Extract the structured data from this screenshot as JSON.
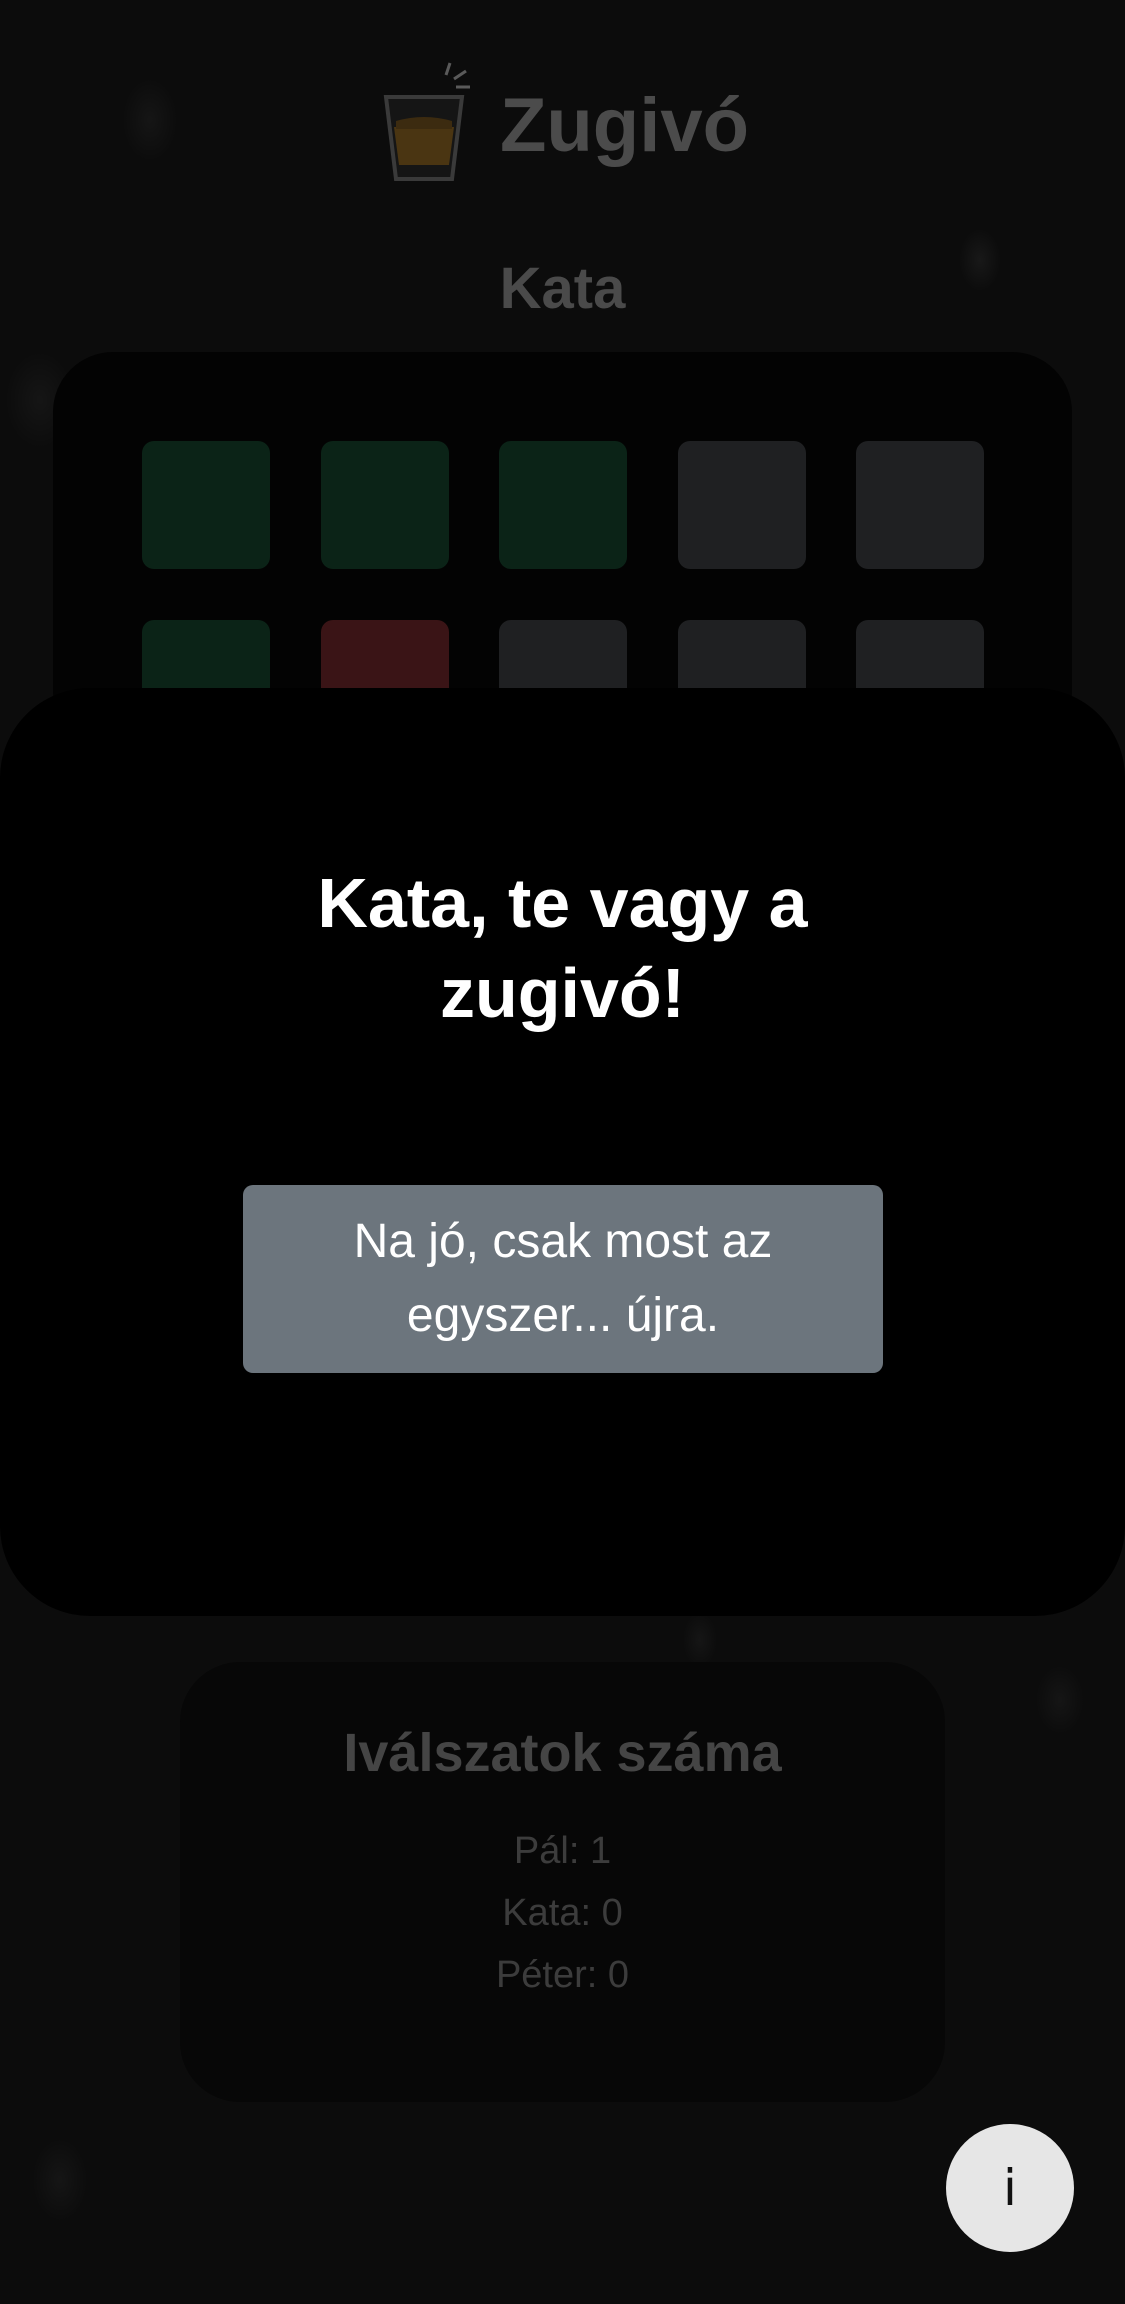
{
  "header": {
    "app_title": "Zugivó",
    "logo_icon": "shot-glass-icon"
  },
  "current_player": "Kata",
  "grid": {
    "cells": [
      {
        "state": "drunk",
        "color": "#0b2317"
      },
      {
        "state": "drunk",
        "color": "#0b2317"
      },
      {
        "state": "drunk",
        "color": "#0b2317"
      },
      {
        "state": "unrevealed",
        "color": "#1f2022"
      },
      {
        "state": "unrevealed",
        "color": "#1f2022"
      },
      {
        "state": "drunk",
        "color": "#0b2317"
      },
      {
        "state": "loser",
        "color": "#3a1416"
      },
      {
        "state": "unrevealed",
        "color": "#1f2022"
      },
      {
        "state": "unrevealed",
        "color": "#1f2022"
      },
      {
        "state": "unrevealed",
        "color": "#1f2022"
      }
    ]
  },
  "modal": {
    "title_line1": "Kata, te vagy a",
    "title_line2": "zugivó!",
    "button_line1": "Na jó, csak most az",
    "button_line2": "egyszer... újra."
  },
  "stats": {
    "title": "Iválszatok száma",
    "rows": [
      "Pál: 1",
      "Kata: 0",
      "Péter: 0"
    ]
  },
  "info_button": {
    "label": "i",
    "icon": "info-icon"
  },
  "colors": {
    "button_bg": "#6c757d",
    "modal_bg": "#000000",
    "page_bg": "#0c0c0c",
    "green_cell": "#0b2317",
    "red_cell": "#3a1416"
  }
}
